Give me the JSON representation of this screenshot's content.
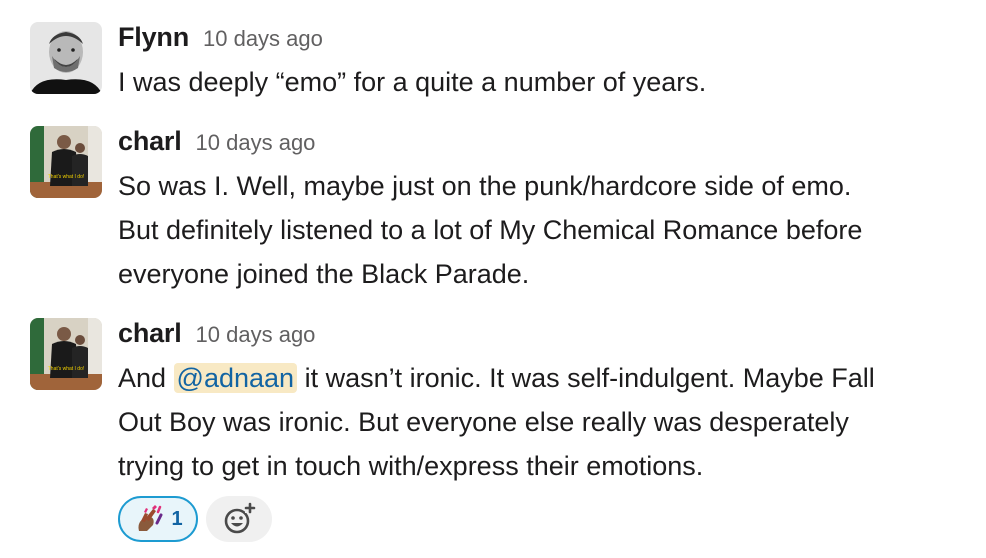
{
  "messages": [
    {
      "sender": "Flynn",
      "timestamp": "10 days ago",
      "avatar_icon": "avatar-photo-flynn",
      "lines": [
        "I was deeply “emo” for a quite a number of years."
      ]
    },
    {
      "sender": "charl",
      "timestamp": "10 days ago",
      "avatar_icon": "avatar-photo-charl",
      "avatar_caption": "That's what I do!",
      "lines": [
        "So was I. Well, maybe just on the punk/hardcore side of emo.",
        "But definitely listened to a lot of My Chemical Romance before",
        "everyone joined the Black Parade."
      ]
    },
    {
      "sender": "charl",
      "timestamp": "10 days ago",
      "avatar_icon": "avatar-photo-charl",
      "avatar_caption": "That's what I do!",
      "line1_before": "And ",
      "mention": "@adnaan",
      "line1_after": " it wasn’t ironic. It was self-indulgent. Maybe Fall",
      "lines": [
        "Out Boy was ironic. But everyone else really was desperately",
        "trying to get in touch with/express their emotions."
      ]
    }
  ],
  "reaction": {
    "emoji_icon": "nail-polish-emoji-icon",
    "count": "1"
  },
  "add_reaction_icon": "add-emoji-icon",
  "colors": {
    "mention_bg": "#f8e9c4",
    "mention_text": "#1264a3",
    "reaction_border": "#1d9bd1",
    "reaction_bg": "#e8f5fa",
    "timestamp": "#616061",
    "text": "#1d1c1d"
  }
}
